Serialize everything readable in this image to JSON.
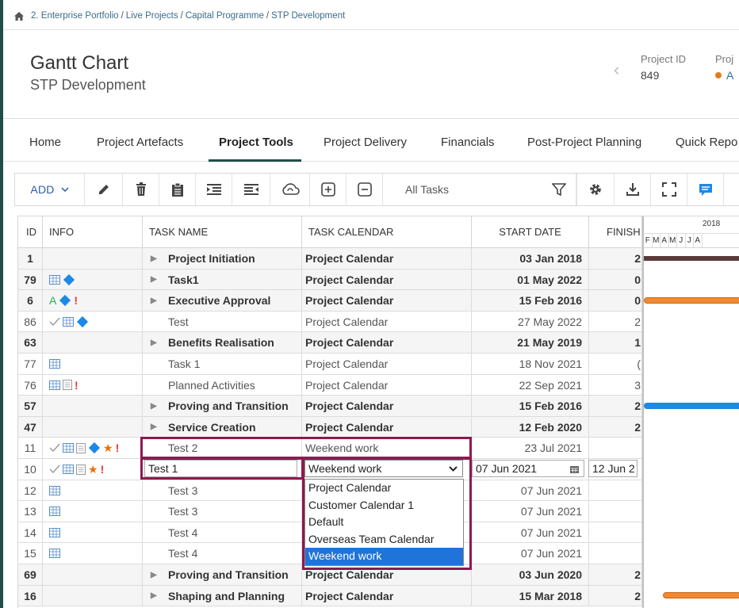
{
  "breadcrumb": {
    "items": [
      "2. Enterprise Portfolio",
      "Live Projects",
      "Capital Programme",
      "STP Development"
    ],
    "separator": "/"
  },
  "header": {
    "title": "Gantt Chart",
    "subtitle": "STP Development",
    "project_id_label": "Project ID",
    "project_id_value": "849",
    "status_label": "Proj",
    "status_value": "A"
  },
  "tabs": [
    {
      "label": "Home"
    },
    {
      "label": "Project Artefacts"
    },
    {
      "label": "Project Tools",
      "active": true
    },
    {
      "label": "Project Delivery"
    },
    {
      "label": "Financials"
    },
    {
      "label": "Post-Project Planning"
    },
    {
      "label": "Quick Repo"
    }
  ],
  "toolbar": {
    "add_label": "ADD",
    "search_value": "All Tasks",
    "icons": [
      "pencil-icon",
      "trash-icon",
      "clipboard-icon",
      "indent-icon",
      "outdent-icon",
      "cloud-sync-icon",
      "expand-plus-icon",
      "collapse-minus-icon",
      "filter-icon",
      "gear-icon",
      "download-icon",
      "fullscreen-icon",
      "chat-icon"
    ]
  },
  "grid": {
    "columns": {
      "id": "ID",
      "info": "INFO",
      "name": "TASK NAME",
      "calendar": "TASK CALENDAR",
      "start": "START DATE",
      "finish": "FINISH"
    },
    "gantt": {
      "year": "2018",
      "months": [
        "F",
        "M",
        "A",
        "M",
        "J",
        "J",
        "A"
      ]
    },
    "rows": [
      {
        "id": "1",
        "name": "Project Initiation",
        "calendar": "Project Calendar",
        "start": "03 Jan 2018",
        "finish": "2",
        "bold": true,
        "expander": true
      },
      {
        "id": "79",
        "name": "Task1",
        "calendar": "Project Calendar",
        "start": "01 May 2022",
        "finish": "0",
        "bold": true,
        "expander": true
      },
      {
        "id": "6",
        "name": "Executive Approval",
        "calendar": "Project Calendar",
        "start": "15 Feb 2016",
        "finish": "0",
        "bold": true,
        "expander": true
      },
      {
        "id": "86",
        "name": "Test",
        "calendar": "Project Calendar",
        "start": "27 May 2022",
        "finish": "2",
        "bold": false,
        "expander": false
      },
      {
        "id": "63",
        "name": "Benefits Realisation",
        "calendar": "Project Calendar",
        "start": "21 May 2019",
        "finish": "1",
        "bold": true,
        "expander": true
      },
      {
        "id": "77",
        "name": "Task 1",
        "calendar": "Project Calendar",
        "start": "18 Nov 2021",
        "finish": "(",
        "bold": false,
        "expander": false
      },
      {
        "id": "76",
        "name": "Planned Activities",
        "calendar": "Project Calendar",
        "start": "22 Sep 2021",
        "finish": "3",
        "bold": false,
        "expander": false
      },
      {
        "id": "57",
        "name": "Proving and Transition",
        "calendar": "Project Calendar",
        "start": "15 Feb 2016",
        "finish": "2",
        "bold": true,
        "expander": true
      },
      {
        "id": "47",
        "name": "Service Creation",
        "calendar": "Project Calendar",
        "start": "12 Feb 2020",
        "finish": "2",
        "bold": true,
        "expander": true
      },
      {
        "id": "11",
        "name": "Test 2",
        "calendar": "Weekend work",
        "start": "23 Jul 2021",
        "finish": "",
        "bold": false,
        "expander": false
      },
      {
        "id": "10",
        "name": "",
        "calendar": "",
        "start": "",
        "finish": "",
        "bold": false,
        "expander": false
      },
      {
        "id": "12",
        "name": "Test 3",
        "calendar": "",
        "start": "07 Jun 2021",
        "finish": "",
        "bold": false,
        "expander": false
      },
      {
        "id": "13",
        "name": "Test 3",
        "calendar": "",
        "start": "07 Jun 2021",
        "finish": "",
        "bold": false,
        "expander": false
      },
      {
        "id": "14",
        "name": "Test 4",
        "calendar": "",
        "start": "07 Jun 2021",
        "finish": "",
        "bold": false,
        "expander": false
      },
      {
        "id": "15",
        "name": "Test 4",
        "calendar": "",
        "start": "07 Jun 2021",
        "finish": "",
        "bold": false,
        "expander": false
      },
      {
        "id": "69",
        "name": "Proving and Transition",
        "calendar": "Project Calendar",
        "start": "03 Jun 2020",
        "finish": "2",
        "bold": true,
        "expander": true
      },
      {
        "id": "16",
        "name": "Shaping and Planning",
        "calendar": "Project Calendar",
        "start": "15 Mar 2018",
        "finish": "2",
        "bold": true,
        "expander": true
      }
    ]
  },
  "edit_row": {
    "name_value": "Test 1",
    "calendar_value": "Weekend work",
    "start_value": "07 Jun 2021",
    "finish_value": "12 Jun 2",
    "options": [
      "Project Calendar",
      "Customer Calendar 1",
      "Default",
      "Overseas Team Calendar",
      "Weekend work"
    ],
    "selected_option": "Weekend work"
  },
  "colors": {
    "brand_dark": "#1f4e47",
    "highlight": "#8e1a4e",
    "selected": "#1e74d8",
    "bar_orange": "#ef8a32",
    "bar_blue": "#1e88e5"
  }
}
